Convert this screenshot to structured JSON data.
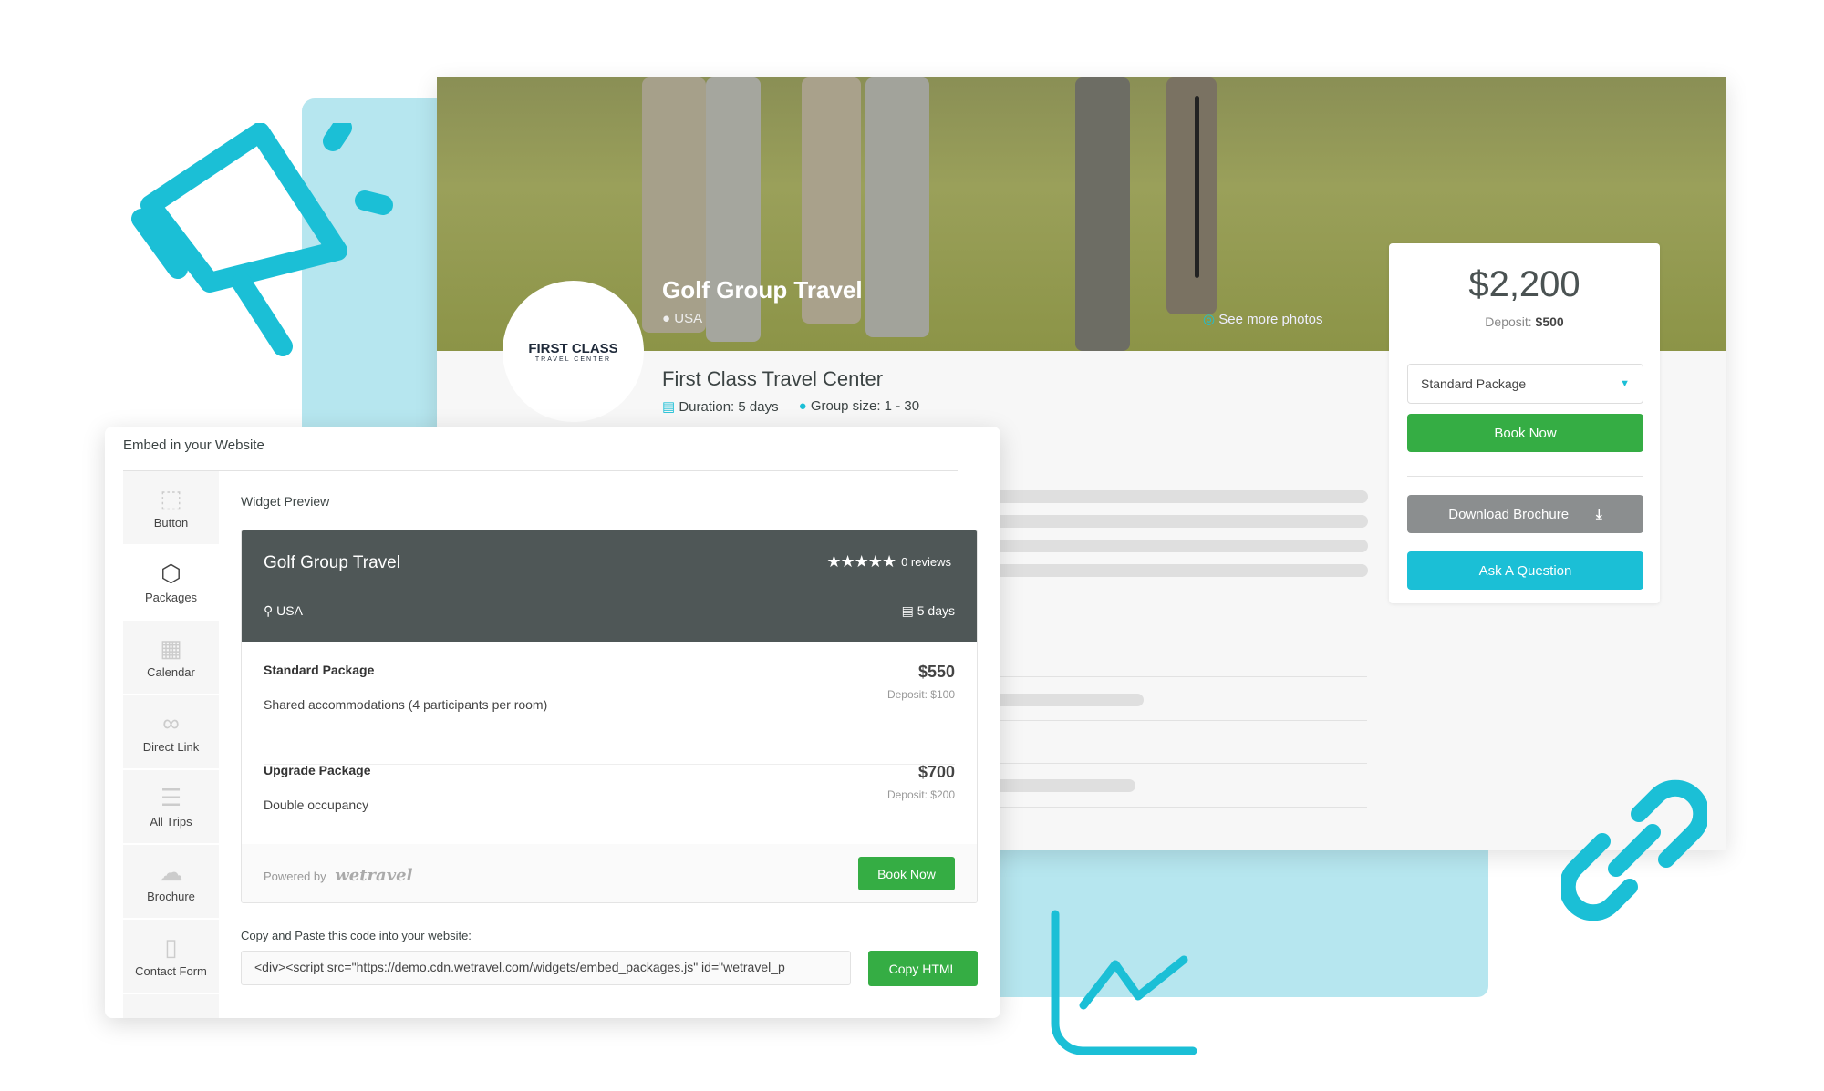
{
  "trip": {
    "title": "Golf Group Travel",
    "location": "USA",
    "see_photos": "See more photos",
    "organizer": "First Class Travel Center",
    "logo_text": "FIRST CLASS",
    "logo_sub": "TRAVEL CENTER",
    "duration": "Duration: 5 days",
    "group_size": "Group size: 1 - 30"
  },
  "booking": {
    "price": "$2,200",
    "deposit_label": "Deposit:",
    "deposit_value": "$500",
    "package_select": "Standard Package",
    "book_now": "Book Now",
    "download_brochure": "Download Brochure",
    "ask_question": "Ask A Question"
  },
  "embed": {
    "title": "Embed in your Website",
    "sidebar": [
      {
        "label": "Button",
        "icon": "cursor-icon"
      },
      {
        "label": "Packages",
        "icon": "cube-icon"
      },
      {
        "label": "Calendar",
        "icon": "calendar-icon"
      },
      {
        "label": "Direct Link",
        "icon": "link-icon"
      },
      {
        "label": "All Trips",
        "icon": "list-icon"
      },
      {
        "label": "Brochure",
        "icon": "cloud-download-icon"
      },
      {
        "label": "Contact Form",
        "icon": "document-icon"
      }
    ],
    "preview_label": "Widget Preview",
    "widget": {
      "title": "Golf Group Travel",
      "rating_stars": 5,
      "reviews": "0 reviews",
      "location": "USA",
      "duration": "5 days",
      "packages": [
        {
          "name": "Standard Package",
          "desc": "Shared accommodations (4 participants per room)",
          "price": "$550",
          "deposit": "Deposit: $100"
        },
        {
          "name": "Upgrade Package",
          "desc": "Double occupancy",
          "price": "$700",
          "deposit": "Deposit: $200"
        }
      ],
      "powered_by": "Powered by",
      "brand": "wetravel",
      "book_now": "Book Now"
    },
    "code_label": "Copy and Paste this code into your website:",
    "code_value": "<div><script src=\"https://demo.cdn.wetravel.com/widgets/embed_packages.js\" id=\"wetravel_p",
    "copy_button": "Copy HTML"
  },
  "colors": {
    "accent": "#1bbfd6",
    "green": "#35ad44",
    "dark": "#4f5757",
    "gray_button": "#8b8e8f"
  }
}
